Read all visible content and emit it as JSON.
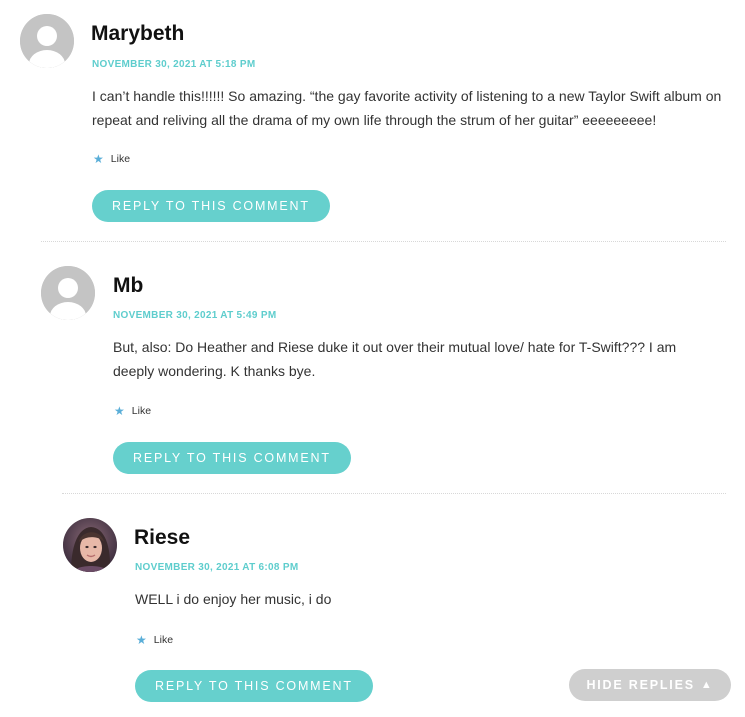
{
  "comments": [
    {
      "author": "Marybeth",
      "date": "NOVEMBER 30, 2021 AT 5:18 PM",
      "text": "I can’t handle this!!!!!! So amazing. “the gay favorite activity of listening to a new Taylor Swift album on repeat and reliving all the drama of my own life through the strum of her guitar” eeeeeeeee!",
      "like_label": "Like",
      "reply_label": "REPLY TO THIS COMMENT",
      "avatar": "default-avatar-icon"
    },
    {
      "author": "Mb",
      "date": "NOVEMBER 30, 2021 AT 5:49 PM",
      "text": "But, also: Do Heather and Riese duke it out over their mutual love/ hate for T-Swift??? I am deeply wondering. K thanks bye.",
      "like_label": "Like",
      "reply_label": "REPLY TO THIS COMMENT",
      "avatar": "default-avatar-icon"
    },
    {
      "author": "Riese",
      "date": "NOVEMBER 30, 2021 AT 6:08 PM",
      "text": "WELL i do enjoy her music, i do",
      "like_label": "Like",
      "reply_label": "REPLY TO THIS COMMENT",
      "avatar": "user-photo-avatar"
    }
  ],
  "hide_replies_label": "HIDE REPLIES",
  "colors": {
    "accent": "#66d0cd",
    "date": "#5ecdcd",
    "like_star": "#5aaed8",
    "hide_replies_bg": "#cfcfcf"
  }
}
